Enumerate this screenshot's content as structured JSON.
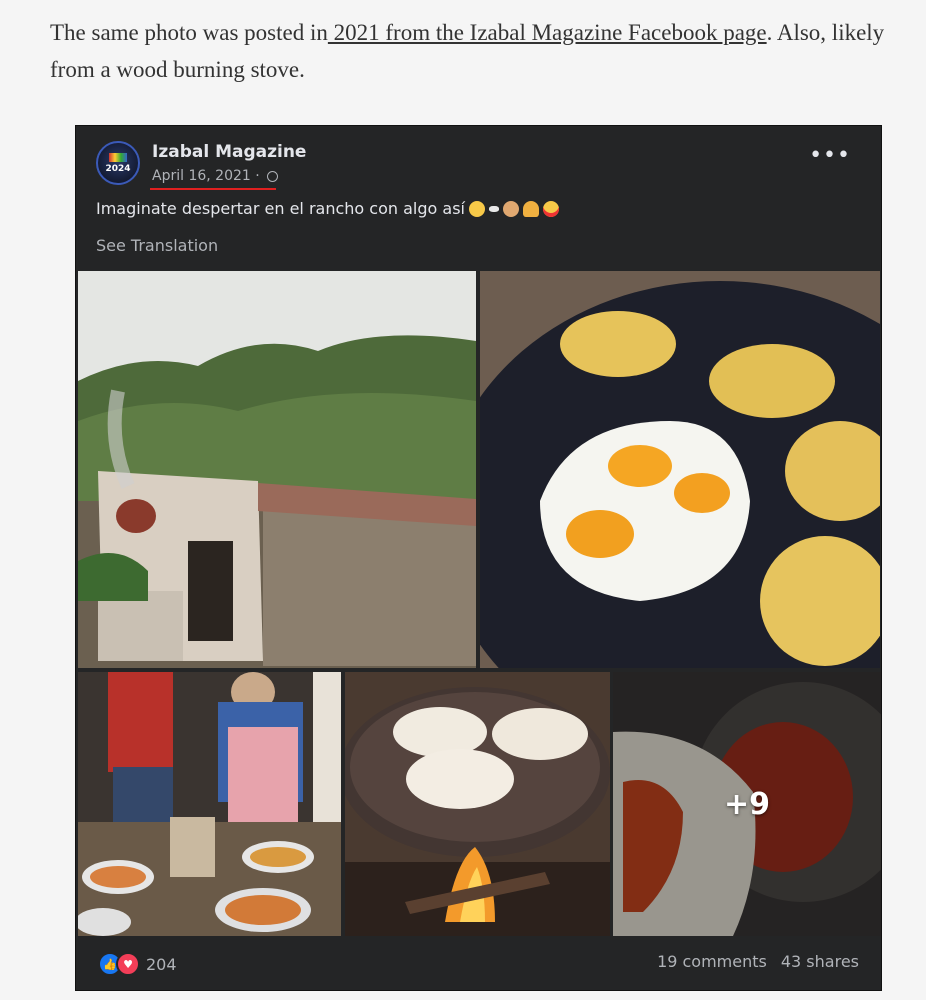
{
  "article": {
    "text_before": "The same photo was posted in",
    "link_text": " 2021 from the Izabal Magazine Facebook page",
    "text_after": ". Also, likely from a wood burning stove."
  },
  "post": {
    "page_name": "Izabal Magazine",
    "avatar_text": "2024",
    "date": "April 16, 2021",
    "date_separator": " · ",
    "text": "Imaginate despertar en el rancho con algo así",
    "see_translation": "See Translation",
    "more_photos": "+9",
    "reaction_count": "204",
    "comments": "19 comments",
    "shares": "43 shares",
    "more_options": "•••"
  },
  "colors": {
    "card_bg": "#242526",
    "date_underline": "#e02020",
    "like": "#1877f2",
    "love": "#f33e58"
  }
}
